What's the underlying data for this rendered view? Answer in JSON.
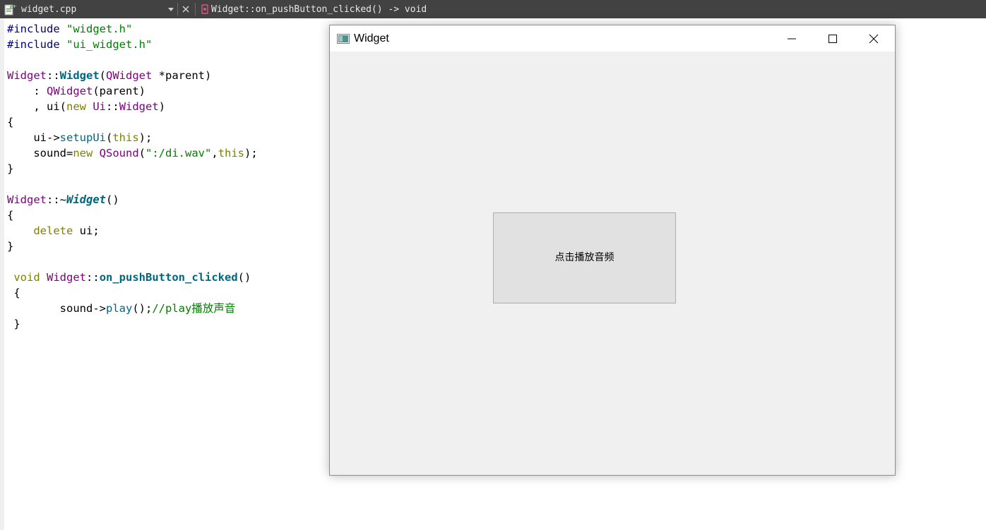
{
  "editor_toolbar": {
    "file_name": "widget.cpp",
    "file_icon": "cpp-file-icon",
    "close_icon": "close-icon",
    "symbol_icon": "function-symbol-icon",
    "symbol": "Widget::on_pushButton_clicked() -> void"
  },
  "code": {
    "l1_kw": "#include",
    "l1_str": "\"widget.h\"",
    "l2_kw": "#include",
    "l2_str": "\"ui_widget.h\"",
    "l4_class": "Widget",
    "l4_sep": "::",
    "l4_fn": "Widget",
    "l4_open": "(",
    "l4_type": "QWidget",
    "l4_param": " *parent)",
    "l5_colon": "    : ",
    "l5_type": "QWidget",
    "l5_rest": "(parent)",
    "l6_comma": "    , ui(",
    "l6_new": "new",
    "l6_sp": " ",
    "l6_ns": "Ui",
    "l6_sep": "::",
    "l6_type": "Widget",
    "l6_close": ")",
    "l7_brace": "{",
    "l8_indent": "    ui->",
    "l8_call": "setupUi",
    "l8_open": "(",
    "l8_this": "this",
    "l8_close": ");",
    "l9_indent": "    sound=",
    "l9_new": "new",
    "l9_sp": " ",
    "l9_type": "QSound",
    "l9_open": "(",
    "l9_str": "\":/di.wav\"",
    "l9_comma": ",",
    "l9_this": "this",
    "l9_close": ");",
    "l10_brace": "}",
    "l12_class": "Widget",
    "l12_sep": "::~",
    "l12_fn": "Widget",
    "l12_paren": "()",
    "l13_brace": "{",
    "l14_indent": "    ",
    "l14_kw": "delete",
    "l14_rest": " ui;",
    "l15_brace": "}",
    "l17_indent": " ",
    "l17_void": "void",
    "l17_sp": " ",
    "l17_class": "Widget",
    "l17_sep": "::",
    "l17_fn": "on_pushButton_clicked",
    "l17_paren": "()",
    "l18_brace": " {",
    "l19_indent": "        sound->",
    "l19_call": "play",
    "l19_rest": "();",
    "l19_comment": "//play播放声音",
    "l20_brace": " }"
  },
  "window": {
    "icon": "app-window-icon",
    "title": "Widget",
    "minimize_icon": "minimize-icon",
    "maximize_icon": "maximize-icon",
    "close_icon": "close-icon",
    "button_label": "点击播放音频"
  },
  "colors": {
    "toolbar_bg": "#424242",
    "preprocessor": "#000080",
    "string": "#008000",
    "type": "#800080",
    "function": "#00677c",
    "keyword": "#808000",
    "comment": "#008000",
    "window_bg": "#f0f0f0",
    "button_bg": "#e1e1e1"
  }
}
